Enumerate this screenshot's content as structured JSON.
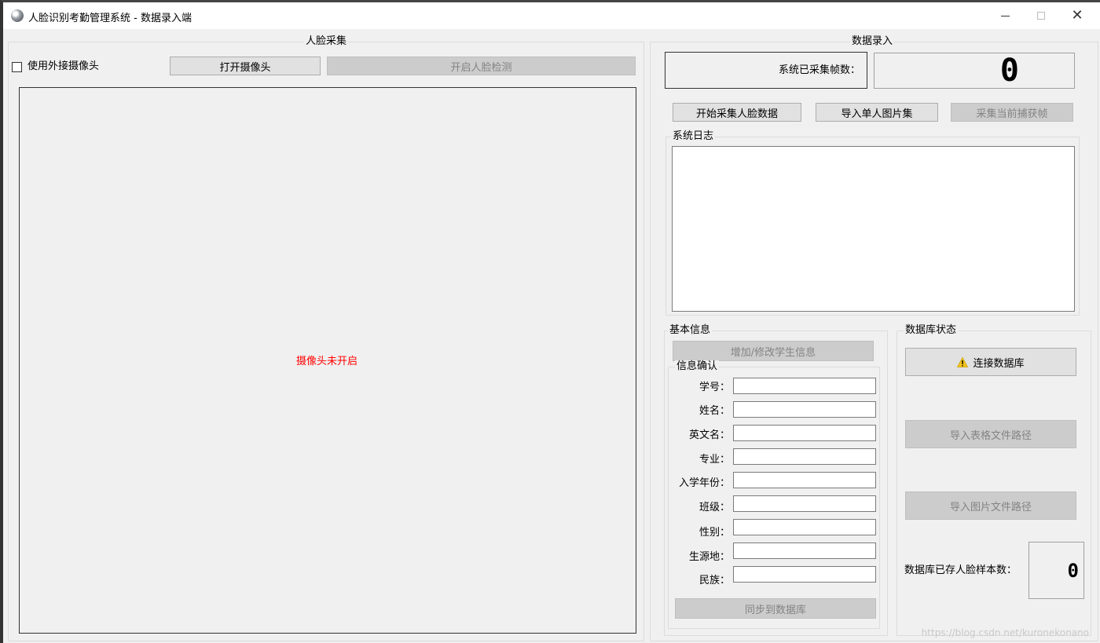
{
  "window": {
    "title": "人脸识别考勤管理系统 - 数据录入端",
    "minimize_icon": "minimize-icon",
    "maximize_icon": "maximize-icon",
    "close_glyph": "✕"
  },
  "capture": {
    "group_title": "人脸采集",
    "external_camera_label": "使用外接摄像头",
    "external_camera_checked": false,
    "open_camera_label": "打开摄像头",
    "face_detect_label": "开启人脸检测",
    "camera_status": "摄像头未开启"
  },
  "entry": {
    "group_title": "数据录入",
    "frames_label": "系统已采集帧数：",
    "frames_count": "0",
    "start_collect_label": "开始采集人脸数据",
    "import_images_label": "导入单人图片集",
    "capture_frame_label": "采集当前捕获帧",
    "log_title": "系统日志",
    "log_text": ""
  },
  "basic_info": {
    "group_title": "基本信息",
    "add_modify_label": "增加/修改学生信息",
    "confirm_title": "信息确认",
    "fields": [
      {
        "label": "学号：",
        "value": ""
      },
      {
        "label": "姓名：",
        "value": ""
      },
      {
        "label": "英文名：",
        "value": ""
      },
      {
        "label": "专业：",
        "value": ""
      },
      {
        "label": "入学年份：",
        "value": ""
      },
      {
        "label": "班级：",
        "value": ""
      },
      {
        "label": "性别：",
        "value": ""
      },
      {
        "label": "生源地：",
        "value": ""
      },
      {
        "label": "民族：",
        "value": ""
      }
    ],
    "sync_label": "同步到数据库"
  },
  "db_status": {
    "group_title": "数据库状态",
    "connect_label": "连接数据库",
    "connect_icon": "warning-icon",
    "import_table_label": "导入表格文件路径",
    "import_image_label": "导入图片文件路径",
    "samples_label": "数据库已存人脸样本数：",
    "samples_count": "0"
  },
  "watermark": "https://blog.csdn.net/kuronekonano",
  "colors": {
    "status_red": "#ff0000",
    "button_bg": "#e1e1e1",
    "disabled_bg": "#cccccc",
    "disabled_text": "#838383",
    "warning_yellow": "#f5c518"
  }
}
